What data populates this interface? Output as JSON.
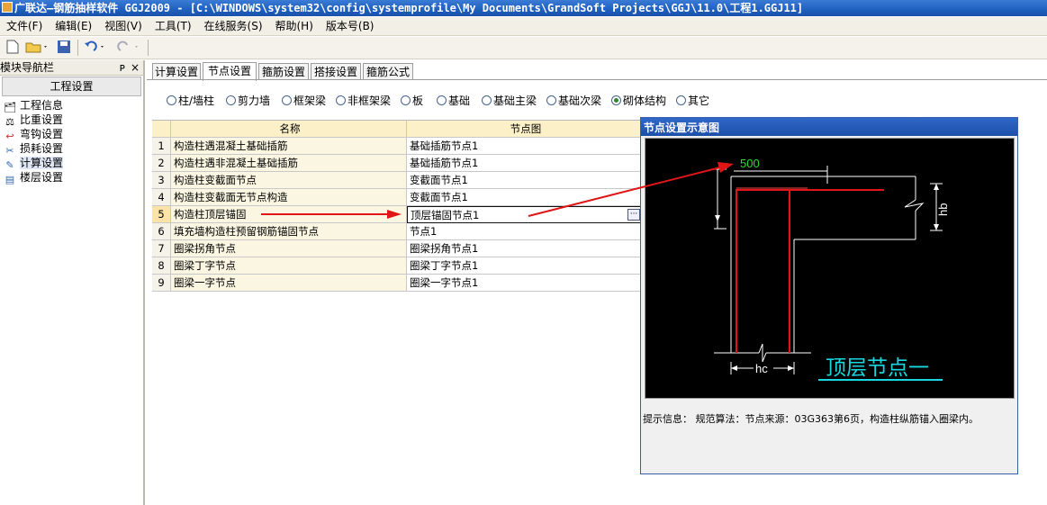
{
  "window": {
    "title": "广联达—钢筋抽样软件 GGJ2009 - [C:\\WINDOWS\\system32\\config\\systemprofile\\My Documents\\GrandSoft Projects\\GGJ\\11.0\\工程1.GGJ11]"
  },
  "menu": [
    "文件(F)",
    "编辑(E)",
    "视图(V)",
    "工具(T)",
    "在线服务(S)",
    "帮助(H)",
    "版本号(B)"
  ],
  "toolbar": {
    "new_icon": "new-file-icon",
    "open_icon": "open-folder-icon",
    "save_icon": "save-icon",
    "undo_icon": "undo-icon",
    "redo_icon": "redo-icon"
  },
  "nav": {
    "header": "模块导航栏",
    "pin": "ᴘ",
    "close": "×",
    "group": "工程设置",
    "items": [
      {
        "label": "工程信息",
        "icon": "project-info-icon"
      },
      {
        "label": "比重设置",
        "icon": "weight-icon"
      },
      {
        "label": "弯钩设置",
        "icon": "hook-icon"
      },
      {
        "label": "损耗设置",
        "icon": "loss-icon"
      },
      {
        "label": "计算设置",
        "icon": "calc-settings-icon"
      },
      {
        "label": "楼层设置",
        "icon": "floor-icon"
      }
    ]
  },
  "tabs": [
    "计算设置",
    "节点设置",
    "箍筋设置",
    "搭接设置",
    "箍筋公式"
  ],
  "active_tab": "节点设置",
  "radios": [
    "柱/墙柱",
    "剪力墙",
    "框架梁",
    "非框架梁",
    "板",
    "基础",
    "基础主梁",
    "基础次梁",
    "砌体结构",
    "其它"
  ],
  "selected_radio": "砌体结构",
  "grid": {
    "headers": [
      "名称",
      "节点图"
    ],
    "rows": [
      {
        "num": "1",
        "name": "构造柱遇混凝土基础插筋",
        "node": "基础插筋节点1"
      },
      {
        "num": "2",
        "name": "构造柱遇非混凝土基础插筋",
        "node": "基础插筋节点1"
      },
      {
        "num": "3",
        "name": "构造柱变截面节点",
        "node": "变截面节点1"
      },
      {
        "num": "4",
        "name": "构造柱变截面无节点构造",
        "node": "变截面节点1"
      },
      {
        "num": "5",
        "name": "构造柱顶层锚固",
        "node": "顶层锚固节点1"
      },
      {
        "num": "6",
        "name": "填充墙构造柱预留钢筋锚固节点",
        "node": "节点1"
      },
      {
        "num": "7",
        "name": "圈梁拐角节点",
        "node": "圈梁拐角节点1"
      },
      {
        "num": "8",
        "name": "圈梁丁字节点",
        "node": "圈梁丁字节点1"
      },
      {
        "num": "9",
        "name": "圈梁一字节点",
        "node": "圈梁一字节点1"
      }
    ],
    "selected_row": 5,
    "ellipsis": "···"
  },
  "dialog": {
    "title": "节点设置示意图",
    "dim_500": "500",
    "dim_hb": "hb",
    "dim_hc": "hc",
    "caption": "顶层节点一",
    "hint": "提示信息： 规范算法：节点来源：03G363第6页，构造柱纵筋锚入圈梁内。"
  },
  "colors": {
    "rebar": "#e01515",
    "drawing_lines": "#ffffff",
    "dimension_green": "#2ddc2d",
    "caption_cyan": "#19d7e0",
    "annotation_arrow": "#e01515"
  }
}
